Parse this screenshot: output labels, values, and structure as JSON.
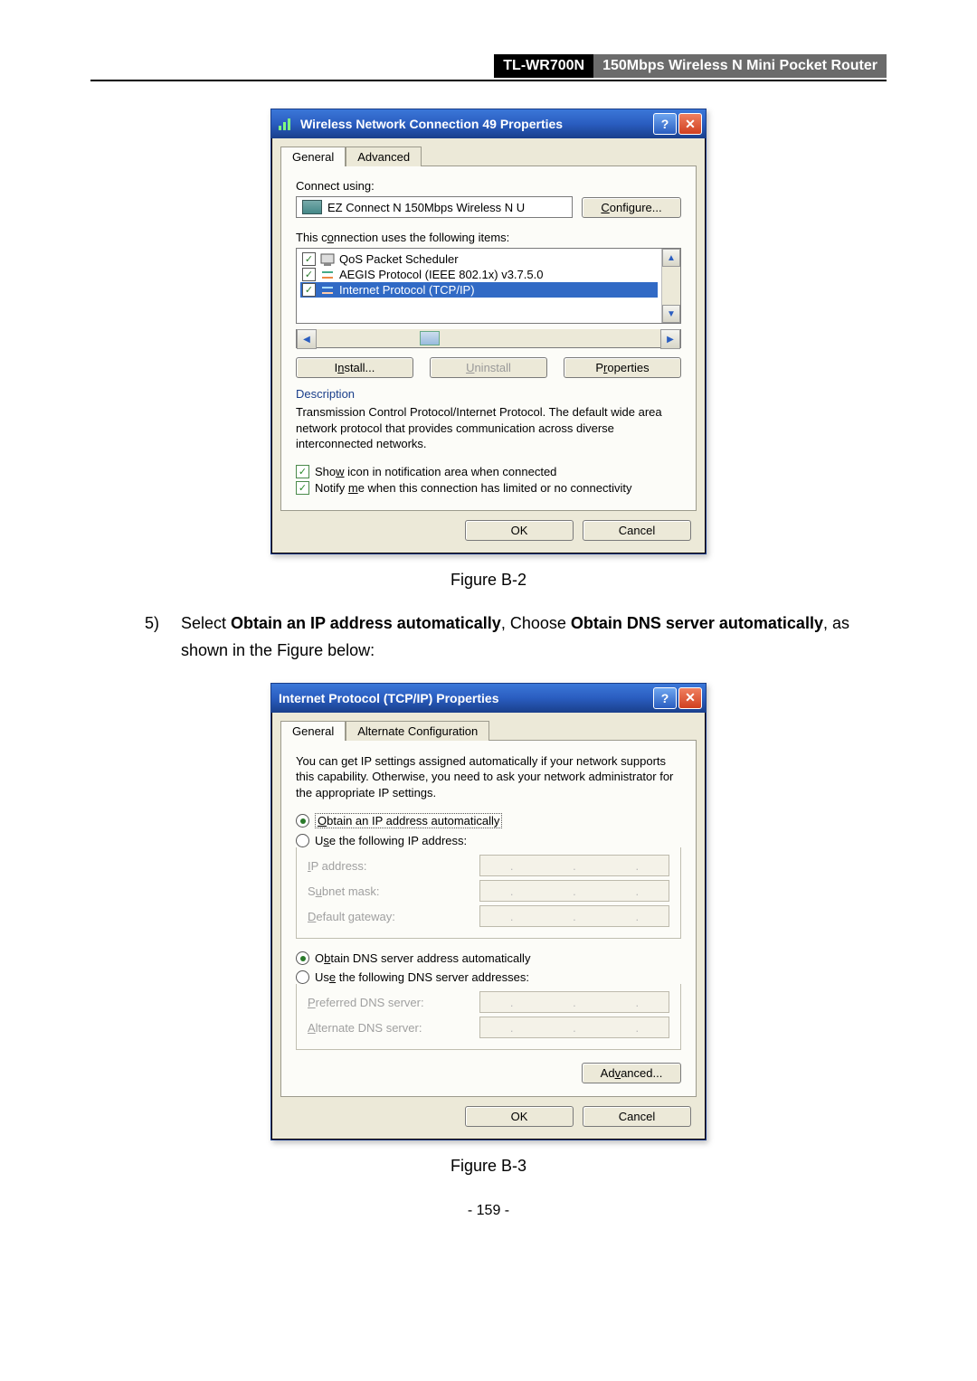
{
  "header": {
    "model": "TL-WR700N",
    "desc": "150Mbps Wireless N Mini Pocket Router"
  },
  "dialog1": {
    "title": "Wireless Network Connection 49 Properties",
    "tabs": [
      "General",
      "Advanced"
    ],
    "connect_label": "Connect using:",
    "adapter": "EZ Connect N 150Mbps Wireless N U",
    "configure": "Configure...",
    "items_label": "This connection uses the following items:",
    "items": [
      {
        "name": "QoS Packet Scheduler",
        "selected": false
      },
      {
        "name": "AEGIS Protocol (IEEE 802.1x) v3.7.5.0",
        "selected": false
      },
      {
        "name": "Internet Protocol (TCP/IP)",
        "selected": true
      }
    ],
    "install": "Install...",
    "uninstall": "Uninstall",
    "properties": "Properties",
    "desc_label": "Description",
    "desc_text": "Transmission Control Protocol/Internet Protocol. The default wide area network protocol that provides communication across diverse interconnected networks.",
    "chk1": "Show icon in notification area when connected",
    "chk2": "Notify me when this connection has limited or no connectivity",
    "ok": "OK",
    "cancel": "Cancel"
  },
  "caption1": "Figure B-2",
  "step": {
    "num": "5)",
    "t1": "Select ",
    "b1": "Obtain an IP address automatically",
    "t2": ", Choose ",
    "b2": "Obtain DNS server automatically",
    "t3": ", as shown in the Figure below:"
  },
  "dialog2": {
    "title": "Internet Protocol (TCP/IP) Properties",
    "tabs": [
      "General",
      "Alternate Configuration"
    ],
    "info": "You can get IP settings assigned automatically if your network supports this capability. Otherwise, you need to ask your network administrator for the appropriate IP settings.",
    "r1": "Obtain an IP address automatically",
    "r2": "Use the following IP address:",
    "f_ip": "IP address:",
    "f_mask": "Subnet mask:",
    "f_gw": "Default gateway:",
    "r3": "Obtain DNS server address automatically",
    "r4": "Use the following DNS server addresses:",
    "f_pdns": "Preferred DNS server:",
    "f_adns": "Alternate DNS server:",
    "advanced": "Advanced...",
    "ok": "OK",
    "cancel": "Cancel"
  },
  "caption2": "Figure B-3",
  "pagenum": "- 159 -"
}
